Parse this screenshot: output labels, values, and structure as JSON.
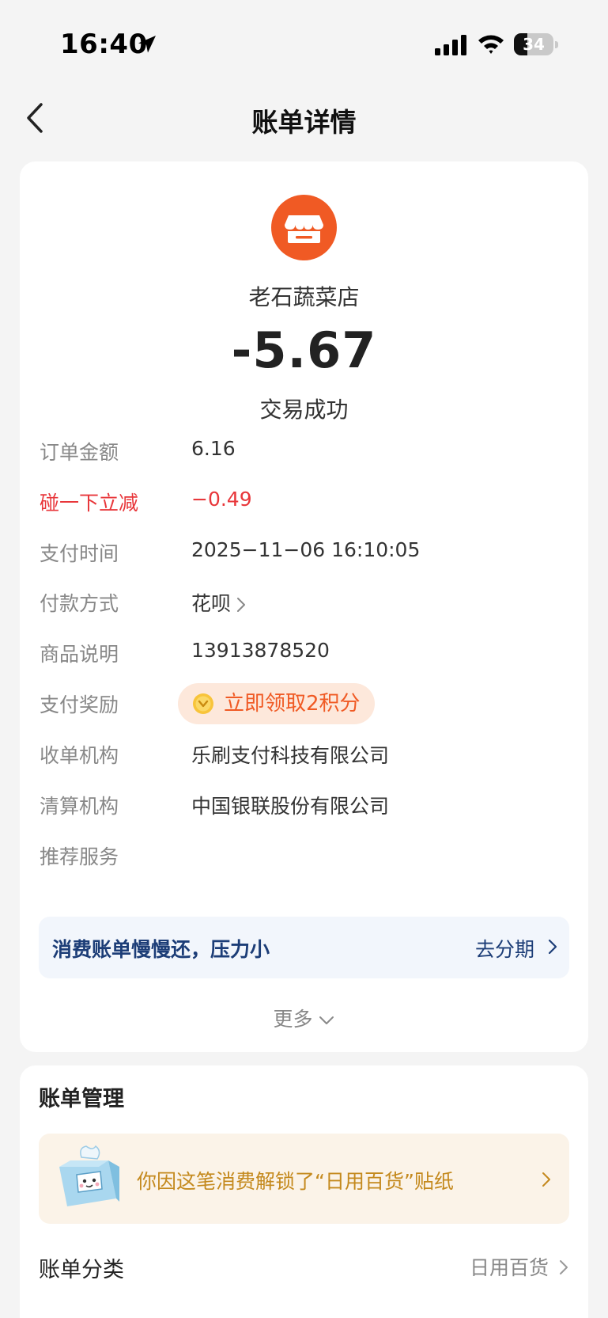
{
  "status_bar": {
    "time": "16:40",
    "battery": "34",
    "battery_level": 0.34
  },
  "nav": {
    "title": "账单详情"
  },
  "merchant": {
    "name": "老石蔬菜店",
    "amount": "-5.67",
    "status": "交易成功"
  },
  "details": [
    {
      "label": "订单金额",
      "value": "6.16"
    },
    {
      "label": "碰一下立减",
      "value": "−0.49"
    },
    {
      "label": "支付时间",
      "value": "2025−11−06 16:10:05"
    },
    {
      "label": "付款方式",
      "value": "花呗"
    },
    {
      "label": "商品说明",
      "value": "13913878520"
    },
    {
      "label": "支付奖励",
      "value": "立即领取2积分"
    },
    {
      "label": "收单机构",
      "value": "乐刷支付科技有限公司"
    },
    {
      "label": "清算机构",
      "value": "中国银联股份有限公司"
    },
    {
      "label": "推荐服务",
      "value": ""
    }
  ],
  "promo": {
    "text": "消费账单慢慢还，压力小",
    "action": "去分期"
  },
  "more_label": "更多",
  "management": {
    "title": "账单管理",
    "sticker_text": "你因这笔消费解锁了“日用百货”贴纸",
    "category_label": "账单分类",
    "category_value": "日用百货"
  },
  "colors": {
    "accent": "#f05a24",
    "discount": "#e8363a",
    "promo_text": "#1c3d77",
    "sticker_text": "#c4891d"
  }
}
